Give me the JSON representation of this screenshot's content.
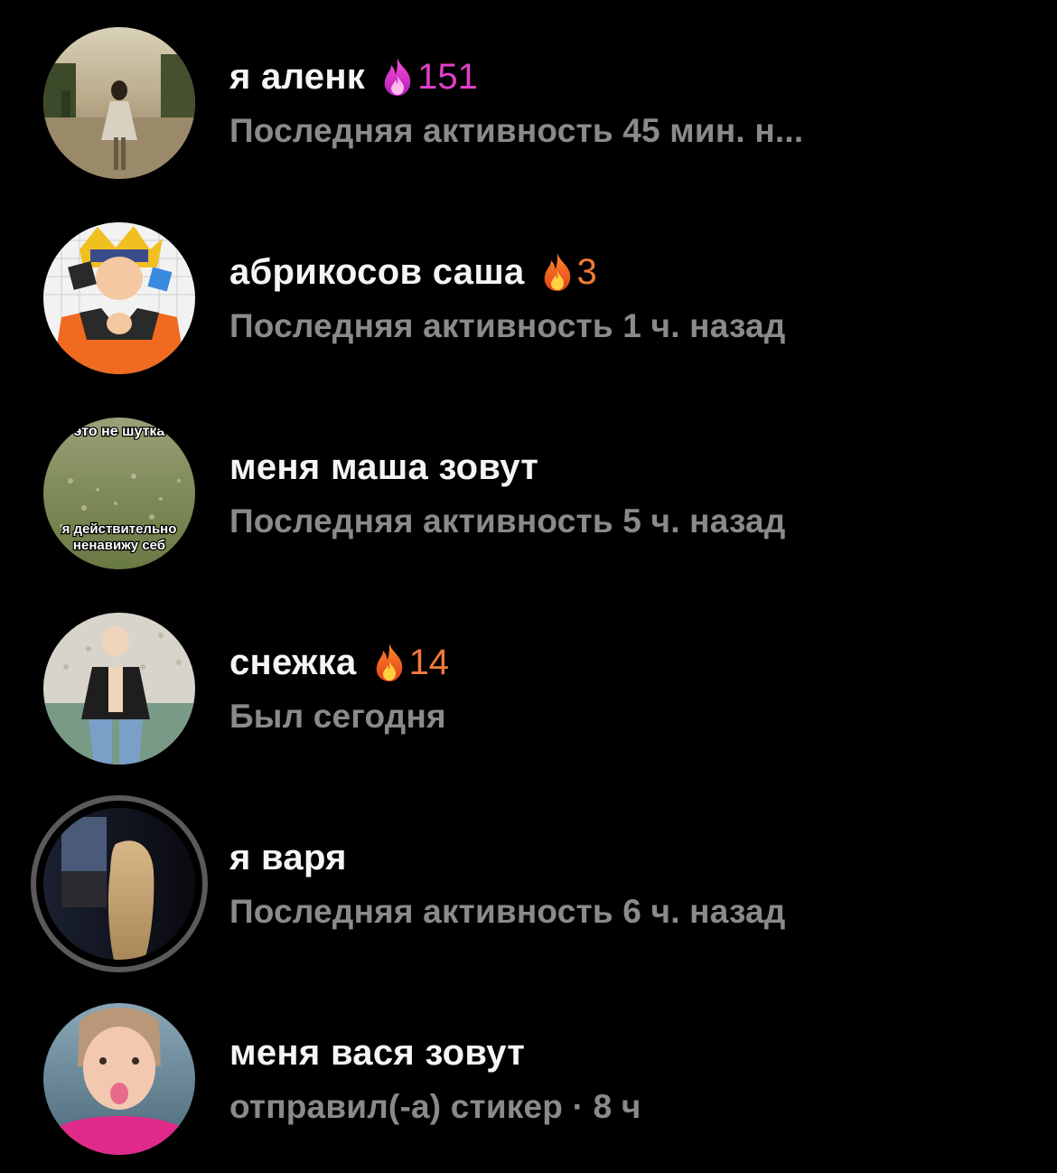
{
  "colors": {
    "background": "#000000",
    "name": "#f5f5f5",
    "status": "#8a8a8a",
    "streak_pink": "#e040c8",
    "streak_orange": "#f07a3a",
    "story_ring": "#5a5a5a"
  },
  "chats": [
    {
      "name": "я аленк",
      "streak": {
        "icon": "flame-pink-icon",
        "count": "151"
      },
      "status": "Последняя активность 45 мин. н..."
    },
    {
      "name": "абрикосов саша",
      "streak": {
        "icon": "flame-orange-icon",
        "count": "3"
      },
      "status": "Последняя активность 1 ч. назад"
    },
    {
      "name": "меня маша зовут",
      "status": "Последняя активность 5 ч. назад",
      "avatar_text": {
        "top": "это не шутка",
        "bottom1": "я действительно",
        "bottom2": "ненавижу себ"
      }
    },
    {
      "name": "снежка",
      "streak": {
        "icon": "flame-orange-icon",
        "count": "14"
      },
      "status": "Был сегодня"
    },
    {
      "name": "я варя",
      "status": "Последняя активность 6 ч. назад",
      "has_story": true
    },
    {
      "name": "меня вася зовут",
      "status": "отправил(-а) стикер · 8 ч"
    }
  ]
}
